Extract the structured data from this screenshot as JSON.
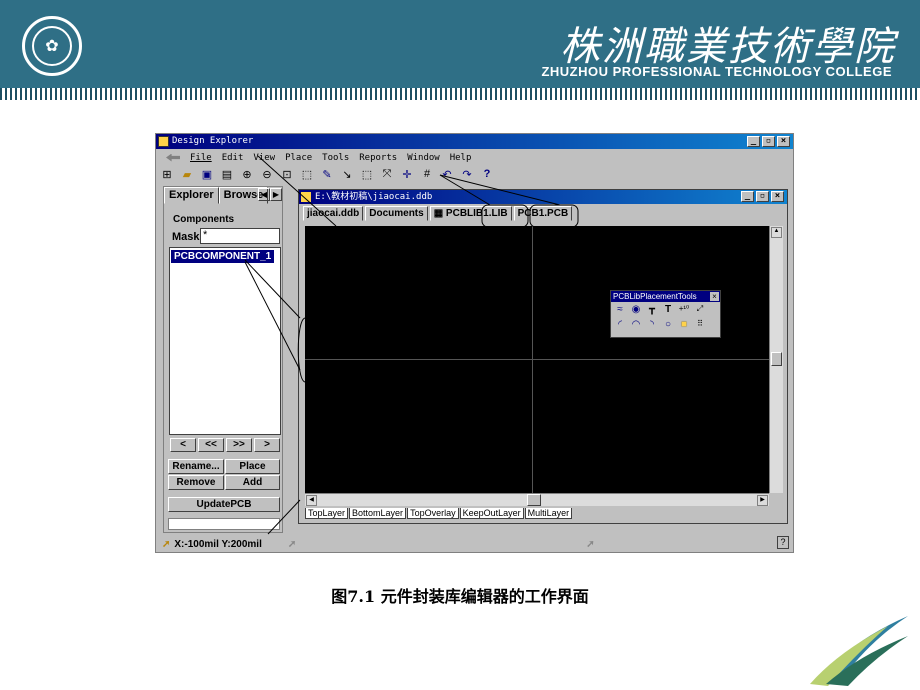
{
  "header": {
    "college_cn": "株洲職業技術學院",
    "college_en": "ZHUZHOU PROFESSIONAL TECHNOLOGY COLLEGE"
  },
  "app": {
    "title": "Design Explorer",
    "menus": [
      "File",
      "Edit",
      "View",
      "Place",
      "Tools",
      "Reports",
      "Window",
      "Help"
    ],
    "toolbar_icons": [
      "explorer-icon",
      "open-icon",
      "save-icon",
      "print-icon",
      "zoom-in-icon",
      "zoom-out-icon",
      "zoom-fit-icon",
      "zoom-area-icon",
      "wire-icon",
      "line-icon",
      "select-icon",
      "move-icon",
      "crosshair-icon",
      "grid-icon",
      "undo-icon",
      "redo-icon",
      "help-icon"
    ]
  },
  "left_panel": {
    "tab_explorer": "Explorer",
    "tab_browse": "Browse",
    "group_title": "Components",
    "mask_label": "Mask",
    "mask_value": "*",
    "components": [
      "PCBCOMPONENT_1"
    ],
    "nav": [
      "<",
      "<<",
      ">>",
      ">"
    ],
    "rename_btn": "Rename...",
    "place_btn": "Place",
    "remove_btn": "Remove",
    "add_btn": "Add",
    "update_btn": "UpdatePCB"
  },
  "document": {
    "title": "E:\\教材初稿\\jiaocai.ddb",
    "tabs": [
      "jiaocai.ddb",
      "Documents",
      "PCBLIB1.LIB",
      "PCB1.PCB"
    ],
    "layers": [
      "TopLayer",
      "BottomLayer",
      "TopOverlay",
      "KeepOutLayer",
      "MultiLayer"
    ]
  },
  "palette": {
    "title": "PCBLibPlacementTools"
  },
  "status": {
    "coords": "X:-100mil Y:200mil"
  },
  "caption": "图7.1 元件封装库编辑器的工作界面"
}
